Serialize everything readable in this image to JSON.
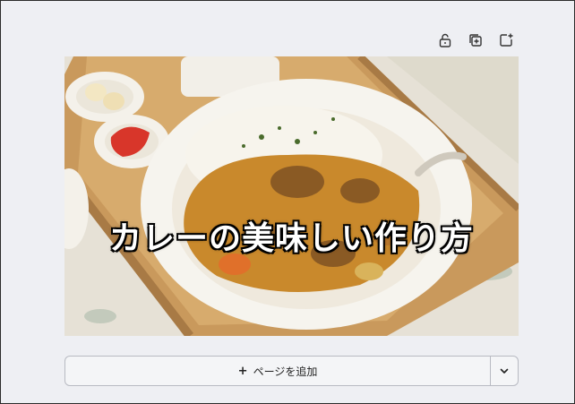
{
  "toolbar": {
    "icons": [
      "unlock-icon",
      "duplicate-page-icon",
      "add-page-icon"
    ]
  },
  "slide": {
    "title": "カレーの美味しい作り方"
  },
  "add_page": {
    "plus": "+",
    "label": "ページを追加"
  }
}
